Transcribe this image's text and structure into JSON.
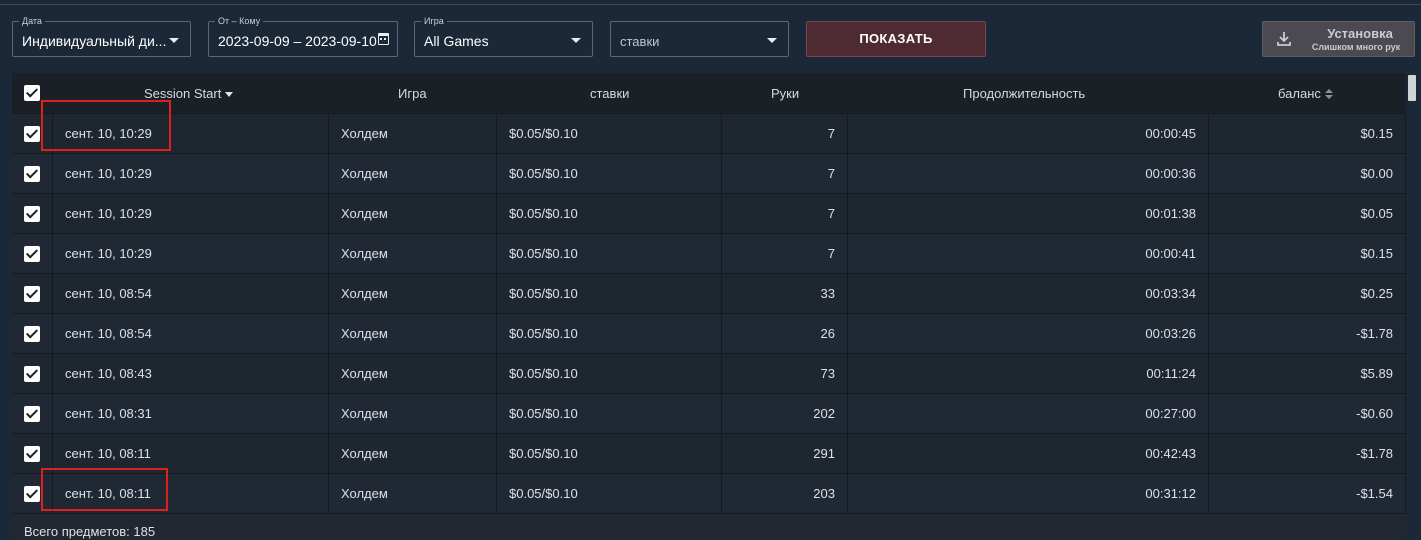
{
  "filters": {
    "date": {
      "label": "Дата",
      "value": "Индивидуальный ди..."
    },
    "from_to": {
      "label": "От – Кому",
      "value": "2023-09-09 – 2023-09-10"
    },
    "game": {
      "label": "Игра",
      "value": "All Games"
    },
    "stakes": {
      "value": "ставки"
    }
  },
  "buttons": {
    "show": "ПОКАЗАТЬ",
    "install_title": "Установка",
    "install_subtitle": "Слишком много рук"
  },
  "table": {
    "headers": {
      "session_start": "Session Start",
      "game": "Игра",
      "stakes": "ставки",
      "hands": "Руки",
      "duration": "Продолжительность",
      "balance": "баланс"
    },
    "rows": [
      {
        "session_start": "сент. 10, 10:29",
        "game": "Холдем",
        "stakes": "$0.05/$0.10",
        "hands": "7",
        "duration": "00:00:45",
        "balance": "$0.15"
      },
      {
        "session_start": "сент. 10, 10:29",
        "game": "Холдем",
        "stakes": "$0.05/$0.10",
        "hands": "7",
        "duration": "00:00:36",
        "balance": "$0.00"
      },
      {
        "session_start": "сент. 10, 10:29",
        "game": "Холдем",
        "stakes": "$0.05/$0.10",
        "hands": "7",
        "duration": "00:01:38",
        "balance": "$0.05"
      },
      {
        "session_start": "сент. 10, 10:29",
        "game": "Холдем",
        "stakes": "$0.05/$0.10",
        "hands": "7",
        "duration": "00:00:41",
        "balance": "$0.15"
      },
      {
        "session_start": "сент. 10, 08:54",
        "game": "Холдем",
        "stakes": "$0.05/$0.10",
        "hands": "33",
        "duration": "00:03:34",
        "balance": "$0.25"
      },
      {
        "session_start": "сент. 10, 08:54",
        "game": "Холдем",
        "stakes": "$0.05/$0.10",
        "hands": "26",
        "duration": "00:03:26",
        "balance": "-$1.78"
      },
      {
        "session_start": "сент. 10, 08:43",
        "game": "Холдем",
        "stakes": "$0.05/$0.10",
        "hands": "73",
        "duration": "00:11:24",
        "balance": "$5.89"
      },
      {
        "session_start": "сент. 10, 08:31",
        "game": "Холдем",
        "stakes": "$0.05/$0.10",
        "hands": "202",
        "duration": "00:27:00",
        "balance": "-$0.60"
      },
      {
        "session_start": "сент. 10, 08:11",
        "game": "Холдем",
        "stakes": "$0.05/$0.10",
        "hands": "291",
        "duration": "00:42:43",
        "balance": "-$1.78"
      },
      {
        "session_start": "сент. 10, 08:11",
        "game": "Холдем",
        "stakes": "$0.05/$0.10",
        "hands": "203",
        "duration": "00:31:12",
        "balance": "-$1.54"
      }
    ],
    "footer_total": "Всего предметов: 185"
  },
  "colors": {
    "background": "#1b2838",
    "show_button": "#4e2a33",
    "highlight": "#e01f1f"
  }
}
